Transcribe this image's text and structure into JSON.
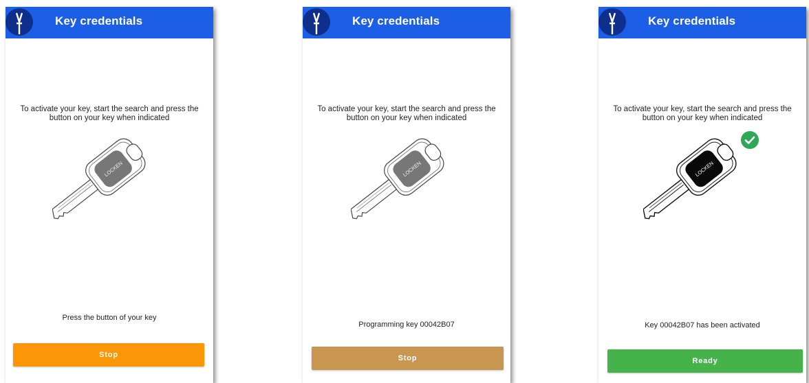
{
  "colors": {
    "appbar": "#1c5ee6",
    "logo_bg": "#0f2f8c",
    "stop_active": "#fb9606",
    "stop_dimmed": "#c89650",
    "ready": "#45b34a",
    "check": "#2fa756"
  },
  "icons": {
    "logo": "vt-logo-icon",
    "key": "key-illustration",
    "check": "check-circle-icon"
  },
  "screens": [
    {
      "title": "Key credentials",
      "logo_letters": "VT",
      "instruction": "To activate your key, start the search and press the button on your key when indicated",
      "key_label": "LOCKEN",
      "status": "Press the button of your key",
      "button_label": "Stop"
    },
    {
      "title": "Key credentials",
      "logo_letters": "VT",
      "instruction": "To activate your key, start the search and press the button on your key when indicated",
      "key_label": "LOCKEN",
      "status": "Programming key 00042B07",
      "button_label": "Stop"
    },
    {
      "title": "Key credentials",
      "logo_letters": "VT",
      "instruction": "To activate your key, start the search and press the button on your key when indicated",
      "key_label": "LOCKEN",
      "status": "Key 00042B07 has been activated",
      "button_label": "Ready"
    }
  ]
}
